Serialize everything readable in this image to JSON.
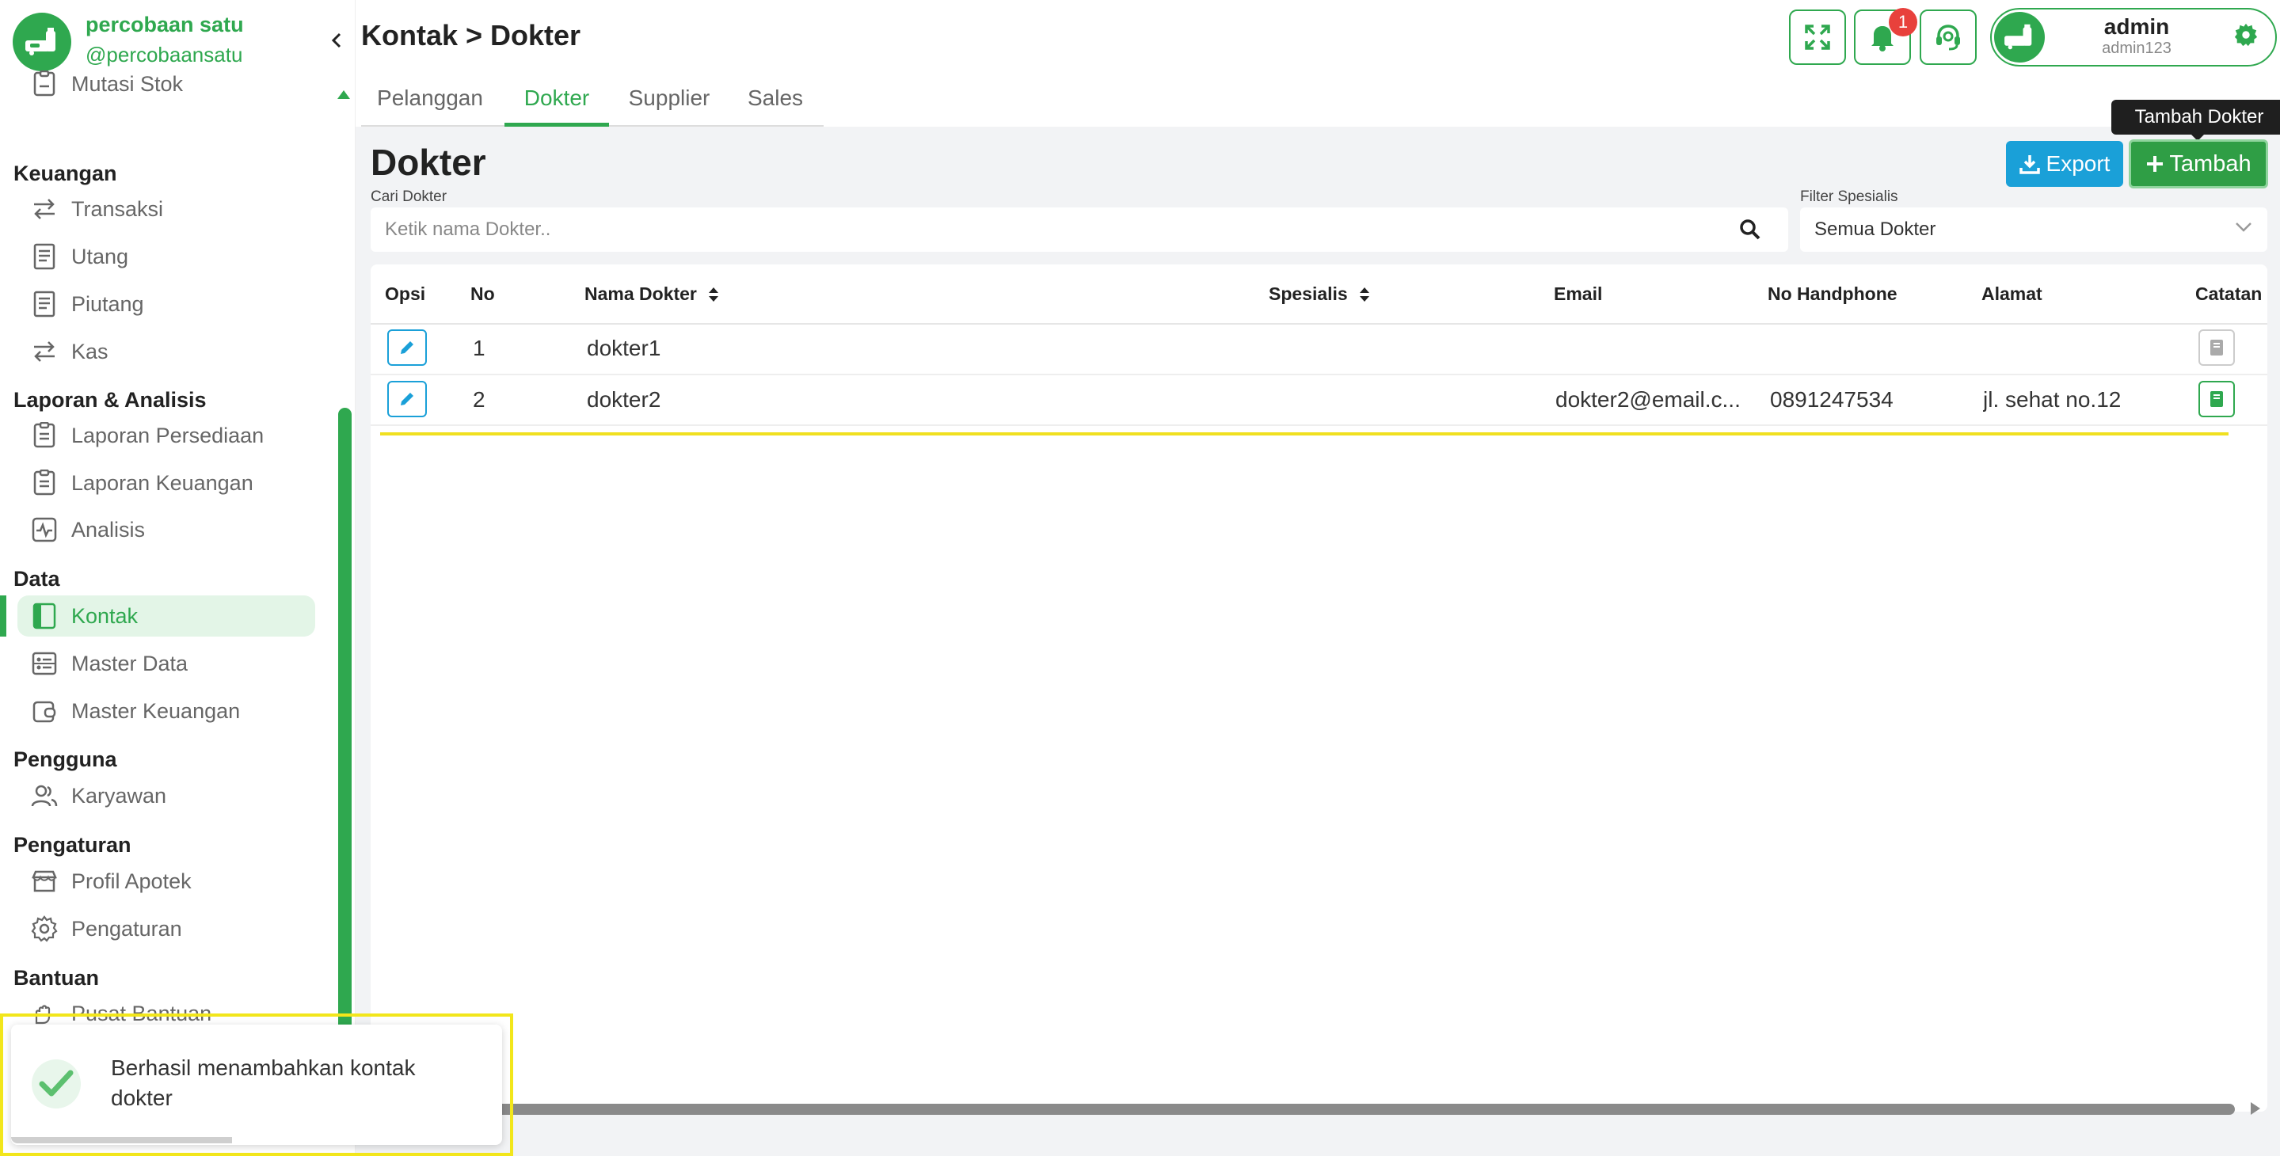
{
  "brand": {
    "name": "percobaan satu",
    "handle": "@percobaansatu"
  },
  "sidebar": {
    "top_items": [
      {
        "label": "Mutasi Stok",
        "icon": "clipboard-icon"
      }
    ],
    "sections": [
      {
        "title": "Keuangan",
        "items": [
          {
            "label": "Transaksi",
            "icon": "transfer-icon"
          },
          {
            "label": "Utang",
            "icon": "receipt-icon"
          },
          {
            "label": "Piutang",
            "icon": "receipt-icon"
          },
          {
            "label": "Kas",
            "icon": "transfer-icon"
          }
        ]
      },
      {
        "title": "Laporan & Analisis",
        "items": [
          {
            "label": "Laporan Persediaan",
            "icon": "clipboard-icon"
          },
          {
            "label": "Laporan Keuangan",
            "icon": "clipboard-icon"
          },
          {
            "label": "Analisis",
            "icon": "activity-icon"
          }
        ]
      },
      {
        "title": "Data",
        "items": [
          {
            "label": "Kontak",
            "icon": "contact-book-icon",
            "active": true
          },
          {
            "label": "Master Data",
            "icon": "database-icon"
          },
          {
            "label": "Master Keuangan",
            "icon": "wallet-icon"
          }
        ]
      },
      {
        "title": "Pengguna",
        "items": [
          {
            "label": "Karyawan",
            "icon": "users-icon"
          }
        ]
      },
      {
        "title": "Pengaturan",
        "items": [
          {
            "label": "Profil Apotek",
            "icon": "store-icon"
          },
          {
            "label": "Pengaturan",
            "icon": "gear-icon"
          }
        ]
      },
      {
        "title": "Bantuan",
        "items": [
          {
            "label": "Pusat Bantuan",
            "icon": "hand-icon"
          }
        ]
      }
    ]
  },
  "header": {
    "breadcrumb": "Kontak > Dokter",
    "notification_count": "1",
    "user": {
      "name": "admin",
      "username": "admin123"
    }
  },
  "tabs": [
    {
      "label": "Pelanggan",
      "active": false
    },
    {
      "label": "Dokter",
      "active": true
    },
    {
      "label": "Supplier",
      "active": false
    },
    {
      "label": "Sales",
      "active": false
    }
  ],
  "page": {
    "title": "Dokter",
    "export_label": "Export",
    "add_label": "Tambah",
    "add_tooltip": "Tambah Dokter",
    "search_label": "Cari Dokter",
    "search_placeholder": "Ketik nama Dokter..",
    "search_value": "",
    "filter_label": "Filter Spesialis",
    "filter_value": "Semua Dokter"
  },
  "table": {
    "columns": {
      "opsi": "Opsi",
      "no": "No",
      "nama": "Nama Dokter",
      "spesialis": "Spesialis",
      "email": "Email",
      "hp": "No Handphone",
      "alamat": "Alamat",
      "catatan": "Catatan"
    },
    "rows": [
      {
        "no": "1",
        "nama": "dokter1",
        "spesialis": "",
        "email": "",
        "hp": "",
        "alamat": "",
        "has_note": false
      },
      {
        "no": "2",
        "nama": "dokter2",
        "spesialis": "",
        "email": "dokter2@email.c...",
        "hp": "0891247534",
        "alamat": "jl. sehat no.12",
        "has_note": true
      }
    ]
  },
  "toast": {
    "message": "Berhasil menambahkan kontak dokter",
    "progress": 0.45
  },
  "colors": {
    "primary": "#2fa84f",
    "info": "#1aa0d8",
    "danger": "#e8413c",
    "highlight": "#f2e61b"
  }
}
